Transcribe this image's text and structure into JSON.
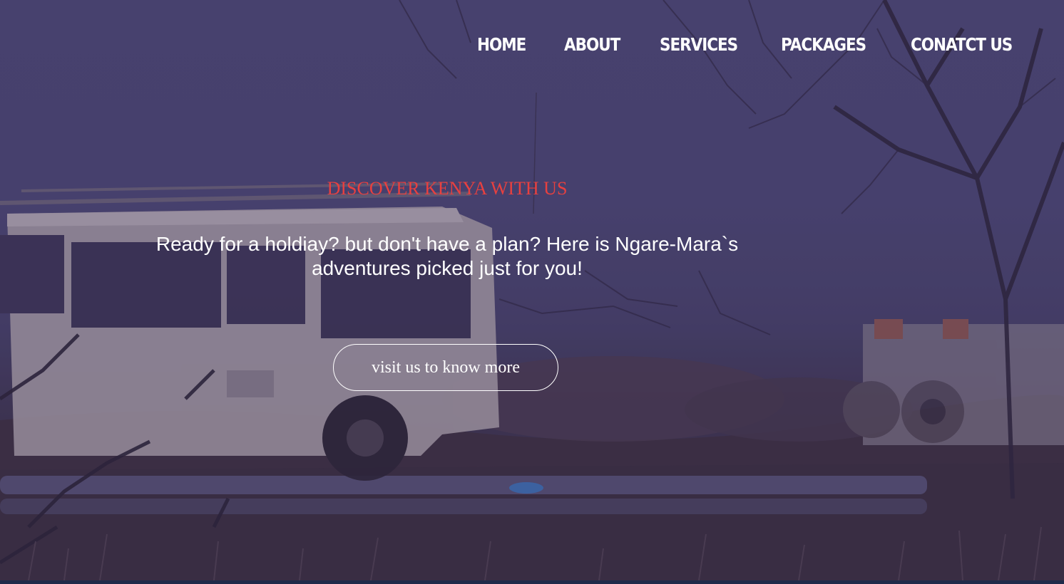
{
  "nav": {
    "items": [
      {
        "label": "HOME"
      },
      {
        "label": "ABOUT"
      },
      {
        "label": "SERVICES"
      },
      {
        "label": "PACKAGES"
      },
      {
        "label": "CONATCT US"
      }
    ]
  },
  "hero": {
    "tagline": "DISCOVER KENYA WITH US",
    "headline": "Ready for a holdiay? but don't have a plan? Here is Ngare-Mara`s adventures picked just for you!",
    "cta_label": "visit us to know more",
    "background_image": "safari-vehicles-in-bush",
    "colors": {
      "tagline": "#e8403f",
      "text": "#ffffff",
      "overlay": "#4a446f"
    }
  }
}
